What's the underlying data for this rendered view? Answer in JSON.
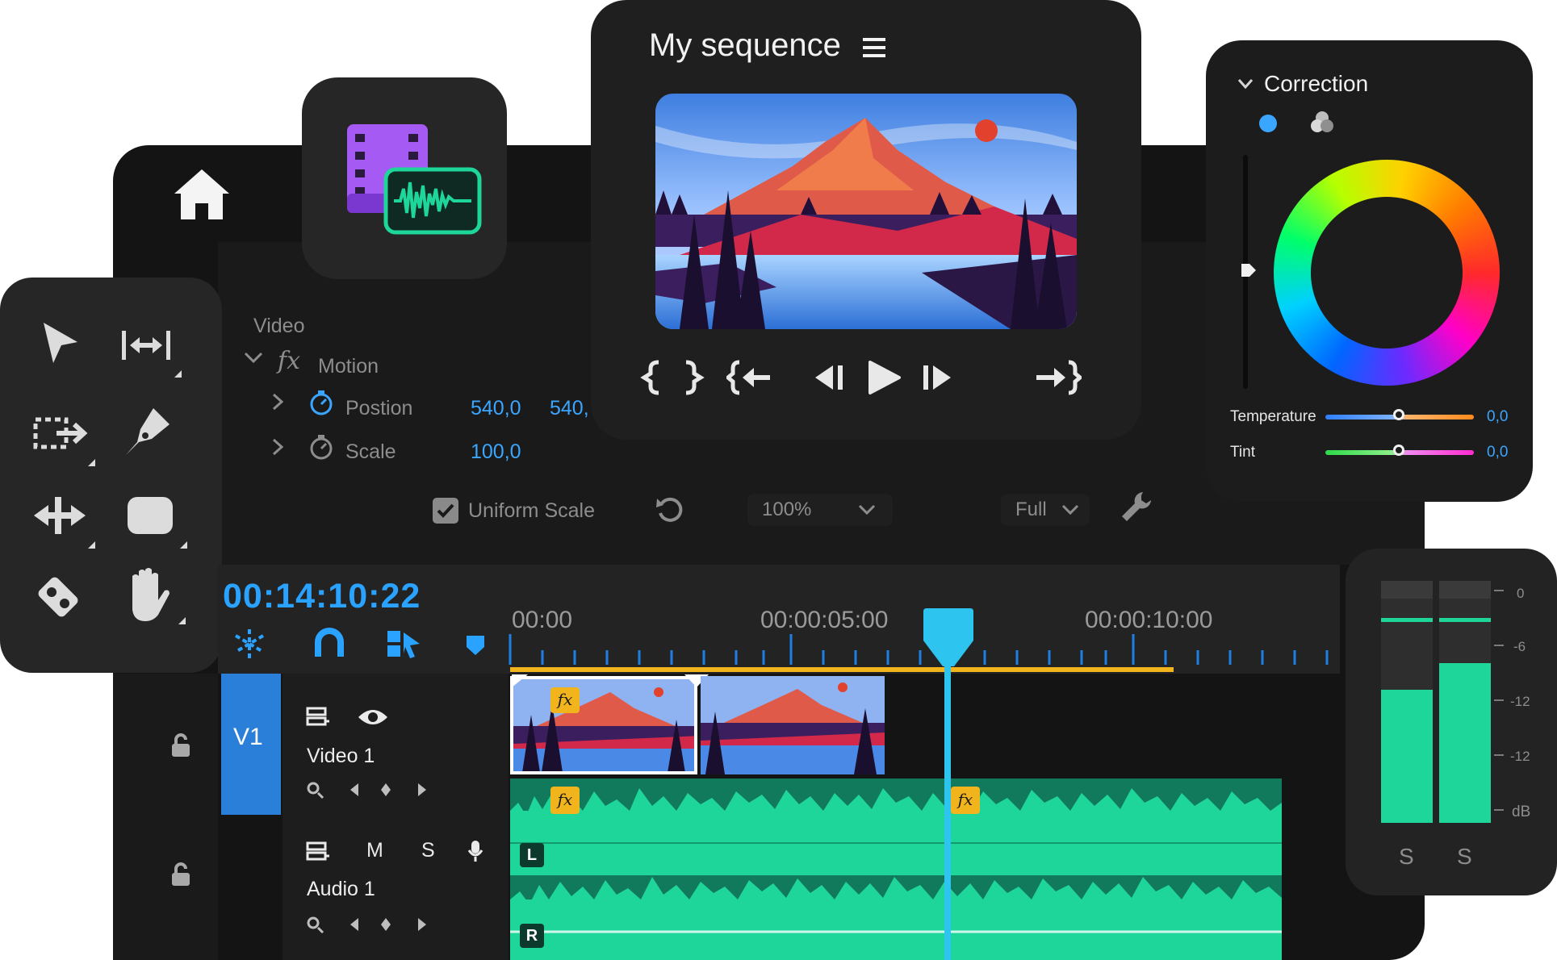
{
  "effects": {
    "section_label": "Video",
    "motion_label": "Motion",
    "fx_glyph": "fx",
    "position_label": "Postion",
    "position_x": "540,0",
    "position_y": "540,",
    "scale_label": "Scale",
    "scale_value": "100,0",
    "uniform_scale_label": "Uniform Scale",
    "uniform_scale_checked": true,
    "zoom_value": "100%",
    "resolution_value": "Full"
  },
  "monitor": {
    "title": "My sequence",
    "controls": [
      "mark-in-icon",
      "mark-out-icon",
      "go-to-in-icon",
      "step-back-icon",
      "play-icon",
      "step-forward-icon",
      "go-to-out-icon"
    ]
  },
  "correction": {
    "title": "Correction",
    "temperature_label": "Temperature",
    "temperature_value": "0,0",
    "temperature_level": 0.5,
    "tint_label": "Tint",
    "tint_value": "0,0",
    "tint_level": 0.5
  },
  "timeline": {
    "timecode": "00:14:10:22",
    "ruler": [
      "00:00",
      "00:00:05:00",
      "00:00:10:00"
    ],
    "playhead_color": "#2ec4f0",
    "accent": "#f2b41c"
  },
  "tracks": {
    "video": {
      "id": "V1",
      "name": "Video 1",
      "fx": "fx"
    },
    "audio": {
      "name": "Audio 1",
      "mute": "M",
      "solo": "S",
      "left": "L",
      "right": "R",
      "fx": "fx"
    }
  },
  "meter": {
    "scale": [
      "0",
      "-6",
      "-12",
      "-12",
      "dB"
    ],
    "solo_left": "S",
    "solo_right": "S",
    "levels": [
      0.55,
      0.66
    ]
  },
  "colors": {
    "audio_green": "#1fd69a",
    "blue_accent": "#3aa6ff",
    "panel_dark": "#1f1f1f"
  }
}
